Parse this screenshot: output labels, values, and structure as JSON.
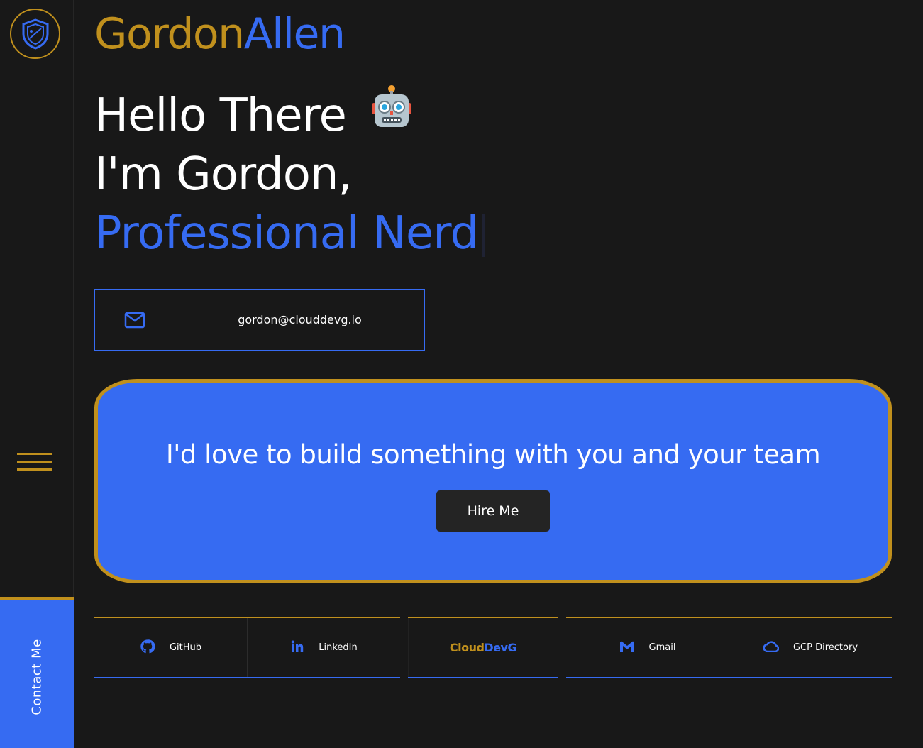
{
  "brand": {
    "first": "Gordon",
    "last": "Allen"
  },
  "hero": {
    "greeting": "Hello There",
    "greeting_emoji": "robot-face",
    "intro": "I'm Gordon,",
    "role": "Professional Nerd"
  },
  "email": {
    "icon": "mail-icon",
    "address": "gordon@clouddevg.io"
  },
  "cta": {
    "text": "I'd love to build something with you and your team",
    "button": "Hire Me"
  },
  "sidebar": {
    "contact_label": "Contact Me",
    "logo": "shield-logo",
    "menu_icon": "hamburger-icon"
  },
  "footer": {
    "left": [
      {
        "label": "GitHub",
        "icon": "github-icon"
      },
      {
        "label": "LinkedIn",
        "icon": "linkedin-icon"
      }
    ],
    "center": {
      "part1": "Cloud",
      "part2": "DevG"
    },
    "right": [
      {
        "label": "Gmail",
        "icon": "gmail-icon"
      },
      {
        "label": "GCP Directory",
        "icon": "gcp-cloud-icon"
      }
    ]
  },
  "colors": {
    "gold": "#c0901d",
    "blue": "#366bf2",
    "background": "#181818",
    "button": "#242424"
  }
}
